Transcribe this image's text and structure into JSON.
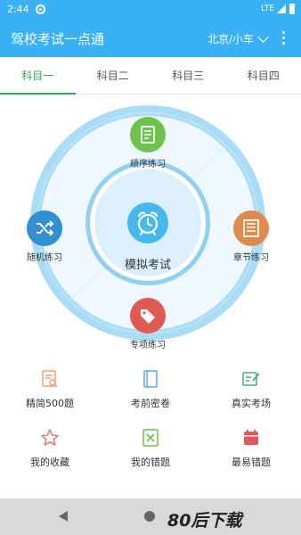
{
  "status": {
    "time": "2:44",
    "network": "LTE"
  },
  "app_bar": {
    "title": "驾校考试一点通",
    "city": "北京/小车"
  },
  "tabs": [
    "科目一",
    "科目二",
    "科目三",
    "科目四"
  ],
  "active_tab": 0,
  "circle_menu": {
    "center": {
      "label": "模拟考试",
      "icon": "alarm-clock-icon"
    },
    "top": {
      "label": "顺序练习",
      "icon": "document-icon",
      "color": "#6cc24a"
    },
    "left": {
      "label": "随机练习",
      "icon": "shuffle-icon",
      "color": "#2f8fd1"
    },
    "right": {
      "label": "章节练习",
      "icon": "list-icon",
      "color": "#e08b4b"
    },
    "bottom": {
      "label": "专项练习",
      "icon": "tag-icon",
      "color": "#e05a54"
    }
  },
  "grid_menu": [
    {
      "label": "精简500题",
      "icon": "notes-search-icon",
      "color": "#f0a070"
    },
    {
      "label": "考前密卷",
      "icon": "book-icon",
      "color": "#5aa8e0"
    },
    {
      "label": "真实考场",
      "icon": "edit-icon",
      "color": "#45b07a"
    },
    {
      "label": "我的收藏",
      "icon": "star-icon",
      "color": "#e07a6a"
    },
    {
      "label": "我的错题",
      "icon": "wrong-box-icon",
      "color": "#6cc24a"
    },
    {
      "label": "最易错题",
      "icon": "calendar-icon",
      "color": "#e05a54"
    }
  ],
  "watermark": "80后下载"
}
